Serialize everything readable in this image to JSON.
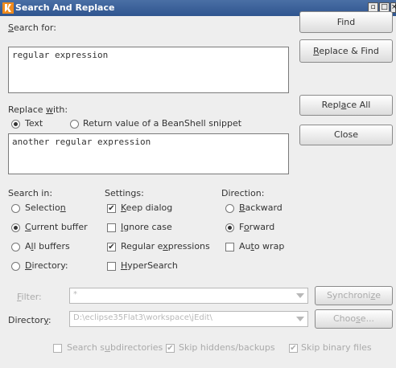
{
  "window": {
    "title": "Search And Replace"
  },
  "search": {
    "label_pre": "",
    "label_u": "S",
    "label_post": "earch for:",
    "value": "regular expression"
  },
  "replace": {
    "label_pre": "Replace ",
    "label_u": "w",
    "label_post": "ith:",
    "value": "another regular expression",
    "mode_text": "Text",
    "mode_beanshell": "Return value of a BeanShell snippet"
  },
  "buttons": {
    "find": "Find",
    "replace_find_u": "R",
    "replace_find_post": "eplace & Find",
    "replace_all_pre": "Repl",
    "replace_all_u": "a",
    "replace_all_post": "ce All",
    "close": "Close"
  },
  "search_in": {
    "heading": "Search in:",
    "selection_pre": "Selectio",
    "selection_u": "n",
    "selection_post": "",
    "current_u": "C",
    "current_post": "urrent buffer",
    "all_pre": "A",
    "all_u": "l",
    "all_post": "l buffers",
    "directory_u": "D",
    "directory_post": "irectory:"
  },
  "settings": {
    "heading": "Settings:",
    "keep_u": "K",
    "keep_post": "eep dialog",
    "ignore_u": "I",
    "ignore_post": "gnore case",
    "regex_pre": "Regular e",
    "regex_u": "x",
    "regex_post": "pressions",
    "hyper_u": "H",
    "hyper_post": "yperSearch"
  },
  "direction": {
    "heading": "Direction:",
    "backward_u": "B",
    "backward_post": "ackward",
    "forward_pre": "F",
    "forward_u": "o",
    "forward_post": "rward",
    "autowrap_pre": "Au",
    "autowrap_u": "t",
    "autowrap_post": "o wrap"
  },
  "filter": {
    "label_u": "F",
    "label_post": "ilter:",
    "value": "*",
    "sync_pre": "Synchroni",
    "sync_u": "z",
    "sync_post": "e"
  },
  "directory": {
    "label_pre": "Director",
    "label_u": "y",
    "label_post": ":",
    "value": "D:\\eclipse35Flat3\\workspace\\jEdit\\",
    "choose_pre": "Choo",
    "choose_u": "s",
    "choose_post": "e..."
  },
  "options": {
    "subdirs_pre": "Search s",
    "subdirs_u": "u",
    "subdirs_post": "bdirectories",
    "hidden": "Skip hiddens/backups",
    "binary": "Skip binary files"
  },
  "state": {
    "text_mode": true,
    "beanshell_mode": false,
    "selection": false,
    "current_buffer": true,
    "all_buffers": false,
    "directory": false,
    "keep_dialog": true,
    "ignore_case": false,
    "regular_expressions": true,
    "hypersearch": false,
    "backward": false,
    "forward": true,
    "auto_wrap": false,
    "search_subdirectories": false,
    "skip_hiddens": true,
    "skip_binary": true
  },
  "colors": {
    "titlebar": "#2f558f",
    "window_bg": "#eeeeee",
    "disabled_text": "#aaaaaa"
  }
}
